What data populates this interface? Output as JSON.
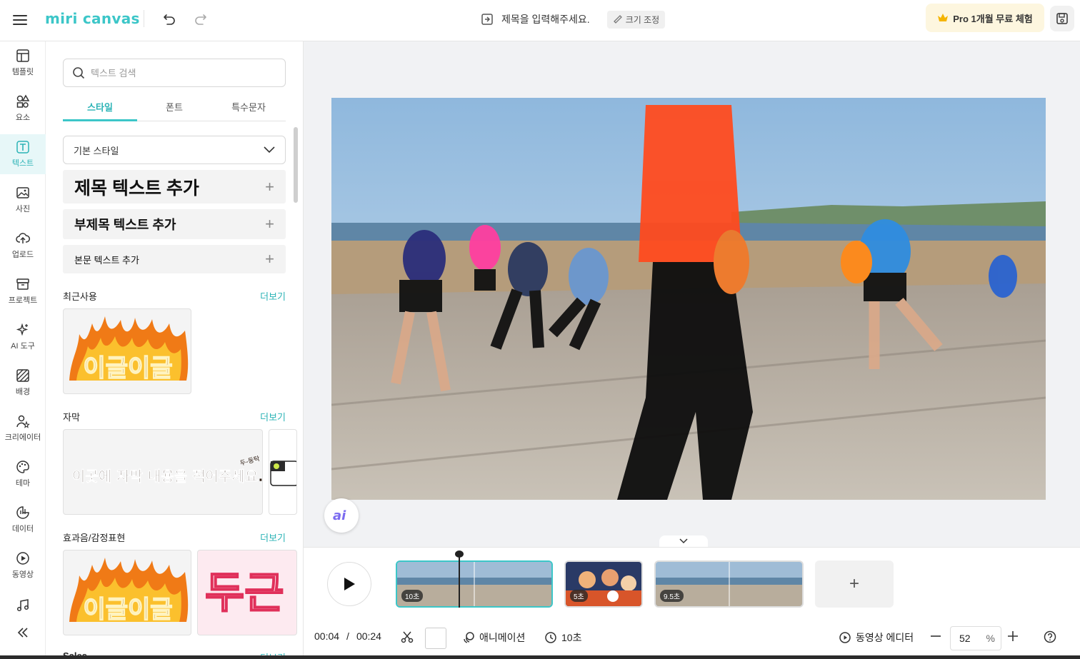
{
  "app": {
    "logo_text": "miri canvas"
  },
  "header": {
    "title_placeholder": "제목을 입력해주세요.",
    "resize_label": "크기 조정",
    "pro_label": "Pro 1개월 무료 체험"
  },
  "rail": [
    {
      "label": "템플릿",
      "icon": "template-icon"
    },
    {
      "label": "요소",
      "icon": "elements-icon"
    },
    {
      "label": "텍스트",
      "icon": "text-icon"
    },
    {
      "label": "사진",
      "icon": "photo-icon"
    },
    {
      "label": "업로드",
      "icon": "upload-icon"
    },
    {
      "label": "프로젝트",
      "icon": "project-icon"
    },
    {
      "label": "AI 도구",
      "icon": "ai-tool-icon"
    },
    {
      "label": "배경",
      "icon": "background-icon"
    },
    {
      "label": "크리에이터",
      "icon": "creator-icon"
    },
    {
      "label": "테마",
      "icon": "theme-icon"
    },
    {
      "label": "데이터",
      "icon": "data-icon"
    },
    {
      "label": "동영상",
      "icon": "video-icon"
    },
    {
      "label": "",
      "icon": "music-icon"
    }
  ],
  "panel": {
    "search_placeholder": "텍스트 검색",
    "tabs": [
      "스타일",
      "폰트",
      "특수문자"
    ],
    "style_select": "기본 스타일",
    "add_title": "제목 텍스트 추가",
    "add_subtitle": "부제목 텍스트 추가",
    "add_body": "본문 텍스트 추가",
    "sections": [
      {
        "title": "최근사용",
        "more": "더보기"
      },
      {
        "title": "자막",
        "more": "더보기"
      },
      {
        "title": "효과음/감정표현",
        "more": "더보기"
      },
      {
        "title": "Sales",
        "more": "더보기"
      }
    ],
    "thumb_texts": {
      "fire": "이글이글",
      "caption": "이곳에 자막 내용을 적어주세요.",
      "caption_tag": "두-둥탁",
      "heart": "두근"
    }
  },
  "timeline": {
    "clips": [
      {
        "duration": "10초"
      },
      {
        "duration": "5초"
      },
      {
        "duration": "9.5초"
      }
    ],
    "add_clip": "+",
    "current_time": "00:04",
    "separator": "/",
    "total_time": "00:24",
    "animation_label": "애니메이션",
    "duration_label": "10초",
    "video_editor_label": "동영상 에디터",
    "zoom_value": "52",
    "zoom_unit": "%"
  },
  "colors": {
    "accent": "#3cc6c8",
    "pro_bg": "#fdf6df"
  }
}
